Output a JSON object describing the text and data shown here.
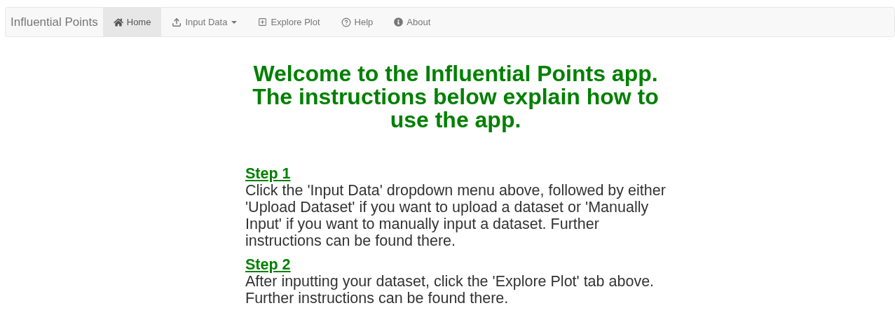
{
  "navbar": {
    "brand": "Influential Points",
    "items": [
      {
        "label": "Home",
        "selected": true,
        "kind": "link"
      },
      {
        "label": "Input Data",
        "selected": false,
        "kind": "dropdown"
      },
      {
        "label": "Explore Plot",
        "selected": false,
        "kind": "link"
      },
      {
        "label": "Help",
        "selected": false,
        "kind": "link"
      },
      {
        "label": "About",
        "selected": false,
        "kind": "link"
      }
    ]
  },
  "heading": "Welcome to the Influential Points app. The instructions below explain how to use the app.",
  "steps": [
    {
      "title": "Step 1",
      "text": "Click the 'Input Data' dropdown menu above, followed by either 'Upload Dataset' if you want to upload a dataset or 'Manually Input' if you want to manually input a dataset. Further instructions can be found there."
    },
    {
      "title": "Step 2",
      "text": "After inputting your dataset, click the 'Explore Plot' tab above. Further instructions can be found there."
    }
  ]
}
